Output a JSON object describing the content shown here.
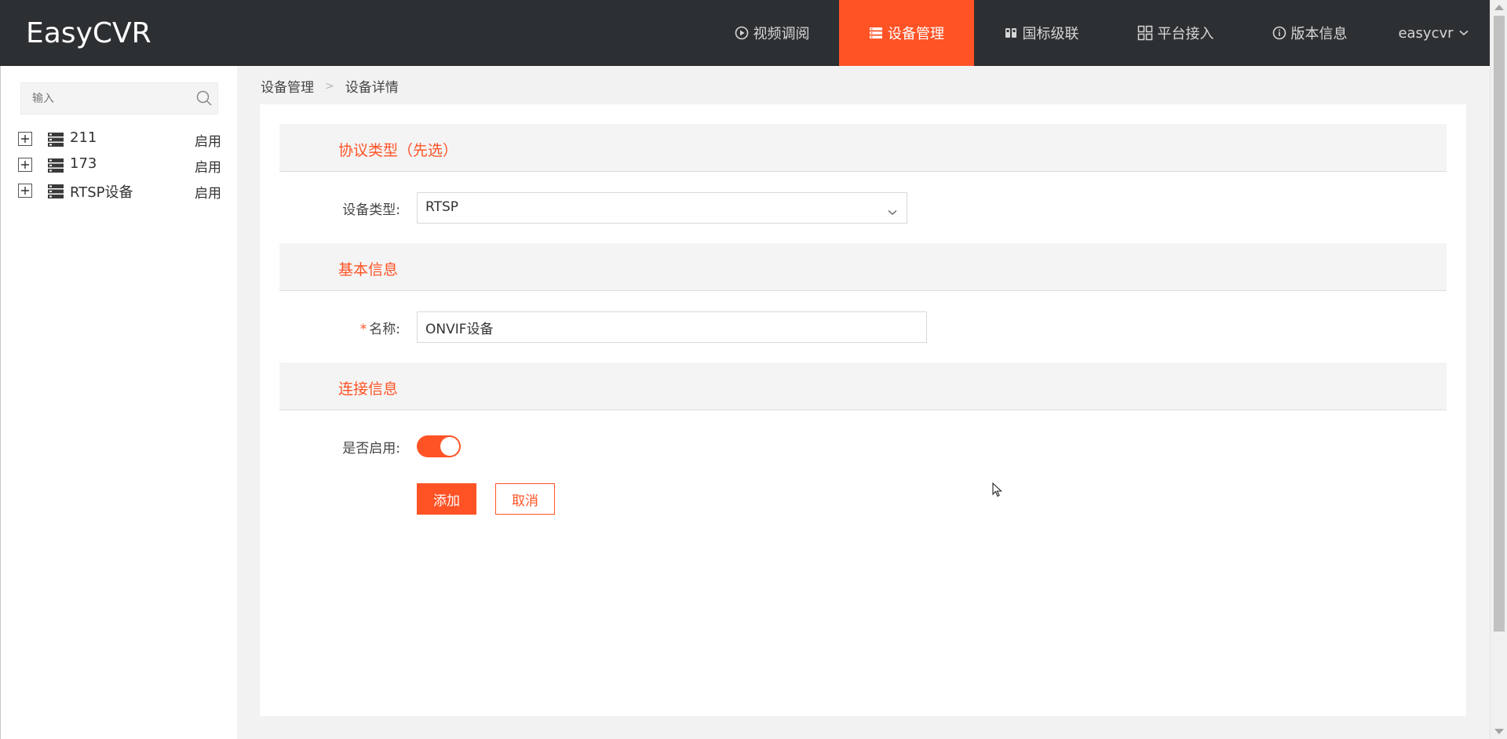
{
  "app": {
    "logo": "EasyCVR"
  },
  "nav": {
    "items": [
      {
        "label": "视频调阅",
        "icon": "play-circle-icon"
      },
      {
        "label": "设备管理",
        "icon": "list-icon",
        "active": true
      },
      {
        "label": "国标级联",
        "icon": "cascade-icon"
      },
      {
        "label": "平台接入",
        "icon": "grid-icon"
      },
      {
        "label": "版本信息",
        "icon": "info-icon"
      }
    ],
    "user": "easycvr"
  },
  "sidebar": {
    "search_placeholder": "输入",
    "tree": [
      {
        "label": "211",
        "status": "启用"
      },
      {
        "label": "173",
        "status": "启用"
      },
      {
        "label": "RTSP设备",
        "status": "启用"
      }
    ]
  },
  "breadcrumb": {
    "root": "设备管理",
    "separator": ">",
    "current": "设备详情"
  },
  "form": {
    "sections": {
      "protocol": "协议类型（先选）",
      "basic": "基本信息",
      "connection": "连接信息"
    },
    "device_type_label": "设备类型:",
    "device_type_value": "RTSP",
    "name_label": "名称:",
    "name_required": "*",
    "name_value": "ONVIF设备",
    "enabled_label": "是否启用:",
    "enabled": true,
    "add_label": "添加",
    "cancel_label": "取消"
  },
  "colors": {
    "accent": "#ff5326",
    "header_bg": "#2d3033"
  }
}
